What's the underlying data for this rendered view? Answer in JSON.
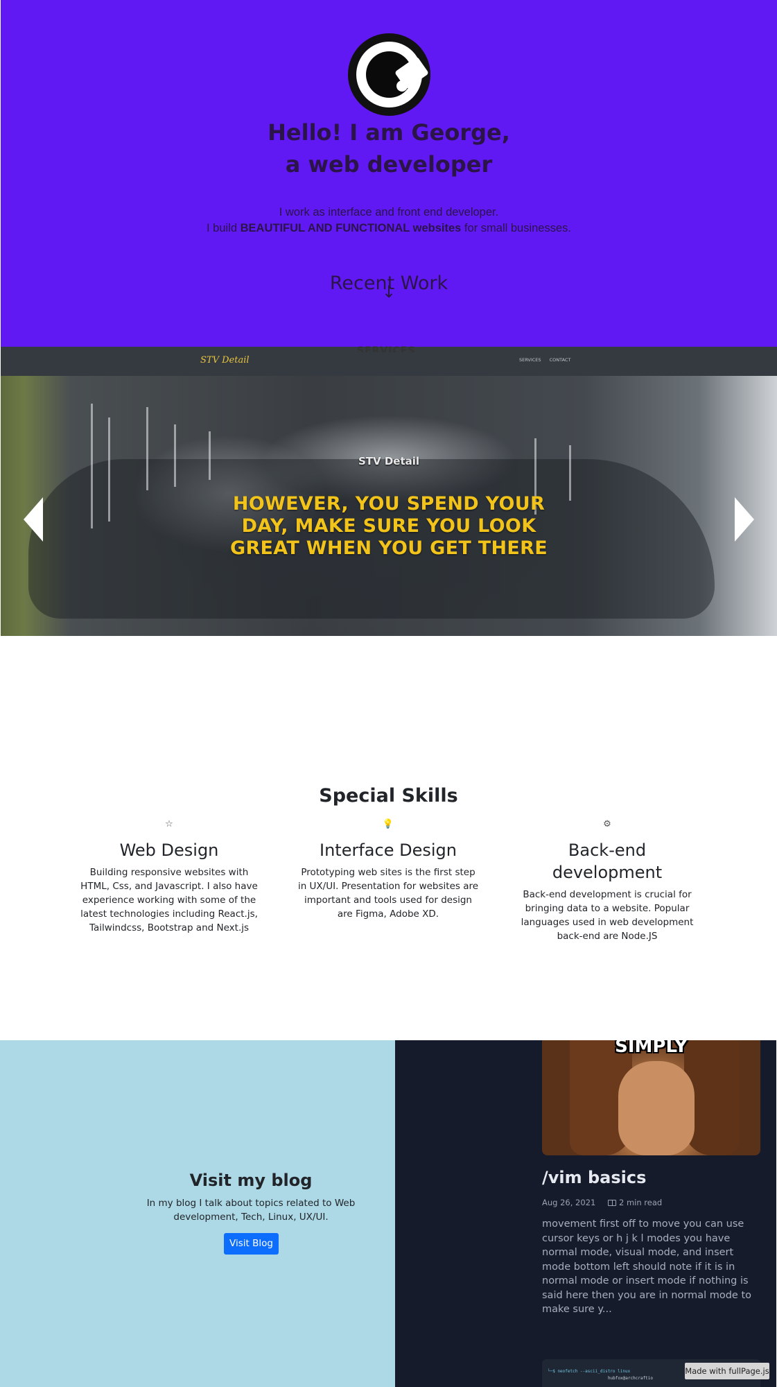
{
  "hero": {
    "title_line1": "Hello! I am George,",
    "title_line2": "a web developer",
    "subtitle_line1": "I work as interface and front end developer.",
    "subtitle_line2_pre": "I build ",
    "subtitle_line2_bold": "BEAUTIFUL AND FUNCTIONAL websites",
    "subtitle_line2_post": " for small businesses.",
    "recent_work_link": "Recent Work",
    "arrow_glyph": "↓"
  },
  "carousel": {
    "site_brand": "STV Detail",
    "nav_links": [
      "SERVICES",
      "CONTACT"
    ],
    "overline": "STV Detail",
    "headline": "HOWEVER, YOU SPEND YOUR DAY, MAKE SURE YOU LOOK GREAT WHEN YOU GET THERE",
    "below_peek": "SERVICES"
  },
  "skills": {
    "section_title": "Special Skills",
    "items": [
      {
        "icon": "star-icon",
        "icon_glyph": "☆",
        "title": "Web Design",
        "text": "Building responsive websites with HTML, Css, and Javascript. I also have experience working with some of the latest technologies including React.js, Tailwindcss, Bootstrap and Next.js"
      },
      {
        "icon": "lightbulb-icon",
        "icon_glyph": "💡",
        "title": "Interface Design",
        "text": "Prototyping web sites is the first step in UX/UI. Presentation for websites are important and tools used for design are Figma, Adobe XD."
      },
      {
        "icon": "gear-icon",
        "icon_glyph": "⚙",
        "title": "Back-end development",
        "text": "Back-end development is crucial for bringing data to a website. Popular languages used in web development back-end are Node.JS"
      }
    ]
  },
  "blog": {
    "title": "Visit my blog",
    "text": "In my blog I talk about topics related to Web development, Tech, Linux, UX/UI.",
    "button_label": "Visit Blog",
    "post": {
      "image_caption": "SIMPLY",
      "title": "/vim basics",
      "date": "Aug 26, 2021",
      "read_time": "2 min read",
      "excerpt": "movement first off to move you can use cursor keys or h j k l modes you have normal mode, visual mode, and insert mode bottom left should note if it is in normal mode or insert mode if nothing is said here then you are in normal mode to make sure y..."
    },
    "second_post_terminal": [
      "└─$ neofetch --ascii_distro linux",
      "hubfox@archcraftio"
    ]
  },
  "fullpage_badge": "Made with fullPage.js",
  "colors": {
    "hero_bg": "#6119f4",
    "headline_yellow": "#f2c31b",
    "blog_left_bg": "#add8e6",
    "blog_right_bg": "#151b2a",
    "button_blue": "#0d6efd"
  }
}
